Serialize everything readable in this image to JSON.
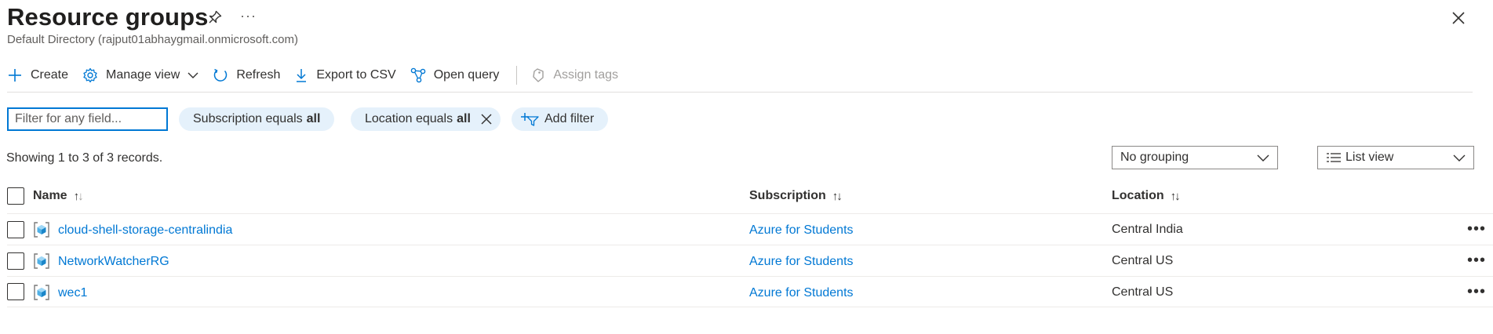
{
  "header": {
    "title": "Resource groups",
    "subtitle": "Default Directory (rajput01abhaygmail.onmicrosoft.com)",
    "more_label": "···"
  },
  "toolbar": {
    "create": "Create",
    "manage_view": "Manage view",
    "refresh": "Refresh",
    "export_csv": "Export to CSV",
    "open_query": "Open query",
    "assign_tags": "Assign tags"
  },
  "filters": {
    "search_placeholder": "Filter for any field...",
    "subscription_label": "Subscription equals",
    "subscription_value": "all",
    "location_label": "Location equals",
    "location_value": "all",
    "add_filter": "Add filter"
  },
  "records": {
    "count_text": "Showing 1 to 3 of 3 records."
  },
  "view_controls": {
    "grouping": "No grouping",
    "view": "List view"
  },
  "table": {
    "columns": {
      "name": "Name",
      "subscription": "Subscription",
      "location": "Location"
    },
    "rows": [
      {
        "name": "cloud-shell-storage-centralindia",
        "subscription": "Azure for Students",
        "location": "Central India"
      },
      {
        "name": "NetworkWatcherRG",
        "subscription": "Azure for Students",
        "location": "Central US"
      },
      {
        "name": "wec1",
        "subscription": "Azure for Students",
        "location": "Central US"
      }
    ],
    "row_more_label": "•••"
  },
  "colors": {
    "accent": "#0078d4",
    "pill_bg": "#e5f1fb",
    "text": "#323130",
    "muted": "#605e5c",
    "disabled": "#a19f9d"
  },
  "icons": {
    "pin": "pin-icon",
    "close": "close-icon",
    "create": "plus-icon",
    "manage_view": "gear-icon",
    "refresh": "refresh-icon",
    "export": "download-icon",
    "open_query": "query-icon",
    "assign_tags": "tag-icon",
    "resource_group": "resource-group-icon"
  }
}
